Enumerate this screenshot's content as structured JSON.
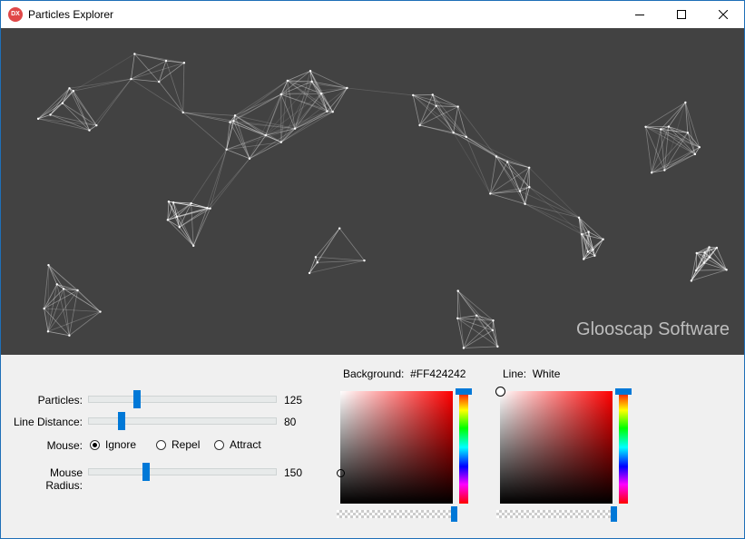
{
  "window": {
    "title": "Particles Explorer",
    "icon_text": "DX",
    "minimize": "minimize",
    "maximize": "maximize",
    "close": "close"
  },
  "canvas": {
    "background": "#424242",
    "line_color": "#ffffff",
    "brand": "Glooscap Software"
  },
  "controls": {
    "particles": {
      "label": "Particles:",
      "value": "125",
      "fraction": 0.26
    },
    "line_distance": {
      "label": "Line Distance:",
      "value": "80",
      "fraction": 0.18
    },
    "mouse": {
      "label": "Mouse:",
      "options": [
        "Ignore",
        "Repel",
        "Attract"
      ],
      "selected": "Ignore"
    },
    "mouse_radius": {
      "label": "Mouse Radius:",
      "value": "150",
      "fraction": 0.31
    }
  },
  "pickers": {
    "background": {
      "label": "Background:",
      "value": "#FF424242",
      "hue": "#ff0000"
    },
    "line": {
      "label": "Line:",
      "value": "White",
      "hue": "#ff0000"
    }
  },
  "accent": "#0078d7"
}
